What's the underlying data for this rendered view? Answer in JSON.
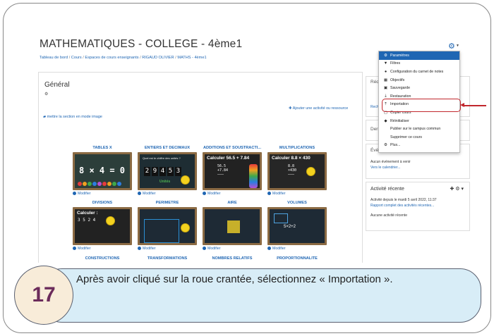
{
  "course": {
    "title": "MATHEMATIQUES - COLLEGE - 4ème1",
    "breadcrumb": [
      "Tableau de bord",
      "Cours",
      "Espaces de cours enseignants",
      "RIGAUD OLIVIER",
      "MATHS - 4ème1"
    ]
  },
  "main": {
    "section_title": "Général",
    "add_activity": "Ajouter une activité ou ressource",
    "image_mode": "mettre la section en mode image",
    "modify_label": "Modifier",
    "tiles_row1": [
      "TABLES X",
      "ENTIERS ET DECIMAUX",
      "ADDITIONS ET SOUSTRACTI...",
      "MULTIPLICATIONS"
    ],
    "tiles_row2": [
      "DIVISIONS",
      "PERIMETRE",
      "AIRE",
      "VOLUMES"
    ],
    "tiles_row3": [
      "CONSTRUCTIONS",
      "TRANSFORMATIONS",
      "NOMBRES RELATIFS",
      "PROPORTIONNALITE"
    ],
    "board_texts": {
      "tables": "8 × 4 = 0",
      "entiers_header": "Quel est le chiffre des unités ?",
      "entiers_digits": [
        "2",
        "9",
        "4",
        "5",
        "3"
      ],
      "entiers_answer": "Unités",
      "additions": "Calculer 56.5 + 7.84",
      "mult": "Calculer 8.8 × 430",
      "divisions": "Calculer :",
      "divisions_num": "3 5 2 4",
      "volumes_expr": "5×2+2"
    }
  },
  "menu": {
    "items": [
      {
        "icon": "⚙",
        "label": "Paramètres",
        "active": true
      },
      {
        "icon": "▼",
        "label": "Filtres",
        "active": false
      },
      {
        "icon": "●",
        "label": "Configuration du carnet de notes",
        "active": false
      },
      {
        "icon": "▦",
        "label": "Objectifs",
        "active": false
      },
      {
        "icon": "▣",
        "label": "Sauvegarde",
        "active": false
      },
      {
        "icon": "⤓",
        "label": "Restauration",
        "active": false
      },
      {
        "icon": "⤒",
        "label": "Importation",
        "active": false
      },
      {
        "icon": "▢",
        "label": "Copier cours",
        "active": false
      },
      {
        "icon": "◆",
        "label": "Réinitialiser",
        "active": false
      },
      {
        "icon": "",
        "label": "Publier sur le campus commun",
        "active": false
      },
      {
        "icon": "",
        "label": "Supprimer ce cours",
        "active": false
      },
      {
        "icon": "⚙",
        "label": "Plus...",
        "active": false
      }
    ]
  },
  "sidebar": {
    "rec_label": "Réc",
    "rec_link": "Rech",
    "der_label": "Derr",
    "eve_label": "Évé",
    "no_event": "Aucun événement à venir",
    "calendar_link": "Vers le calendrier...",
    "recent_title": "Activité récente",
    "recent_since": "Activité depuis le mardi 5 avril 2022, 11:37",
    "recent_report": "Rapport complet des activités récentes...",
    "no_recent": "Aucune activité récente"
  },
  "caption": {
    "step": "17",
    "text": "Après avoir cliqué sur la roue crantée, sélectionnez « Importation »."
  },
  "colors": {
    "link": "#1f66b3",
    "highlight": "#c1272d",
    "caption_bg": "#d8edf7",
    "step_text": "#6b2b5b"
  }
}
